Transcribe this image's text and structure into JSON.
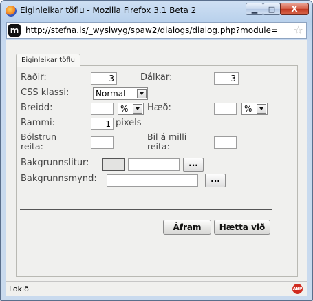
{
  "window": {
    "title": "Eiginleikar töflu - Mozilla Firefox 3.1 Beta 2",
    "min_glyph": "▁",
    "max_glyph": "□",
    "close_glyph": "X"
  },
  "urlbar": {
    "site_glyph": "m",
    "url": "http://stefna.is/_wysiwyg/spaw2/dialogs/dialog.php?module=",
    "star_glyph": "☆"
  },
  "dialog": {
    "tab_label": "Eiginleikar töflu",
    "rows_label": "Raðir:",
    "rows_value": "3",
    "cols_label": "Dálkar:",
    "cols_value": "3",
    "css_label": "CSS klassi:",
    "css_value": "Normal",
    "width_label": "Breidd:",
    "width_unit": "%",
    "height_label": "Hæð:",
    "height_unit": "%",
    "border_label": "Rammi:",
    "border_value": "1",
    "border_unit": "pixels",
    "padding_label_1": "Bólstrun",
    "padding_label_2": "reita:",
    "spacing_label_1": "Bil á milli",
    "spacing_label_2": "reita:",
    "bgcolor_label": "Bakgrunnslitur:",
    "bgimage_label": "Bakgrunnsmynd:",
    "browse_label": "...",
    "ok_label": "Áfram",
    "cancel_label": "Hætta við"
  },
  "status": {
    "text": "Lokið",
    "abp_label": "ABP"
  },
  "colors": {
    "titlebar": "#c7d9ef",
    "close_button": "#c23a22",
    "dialog_bg": "#f0f0ee"
  }
}
